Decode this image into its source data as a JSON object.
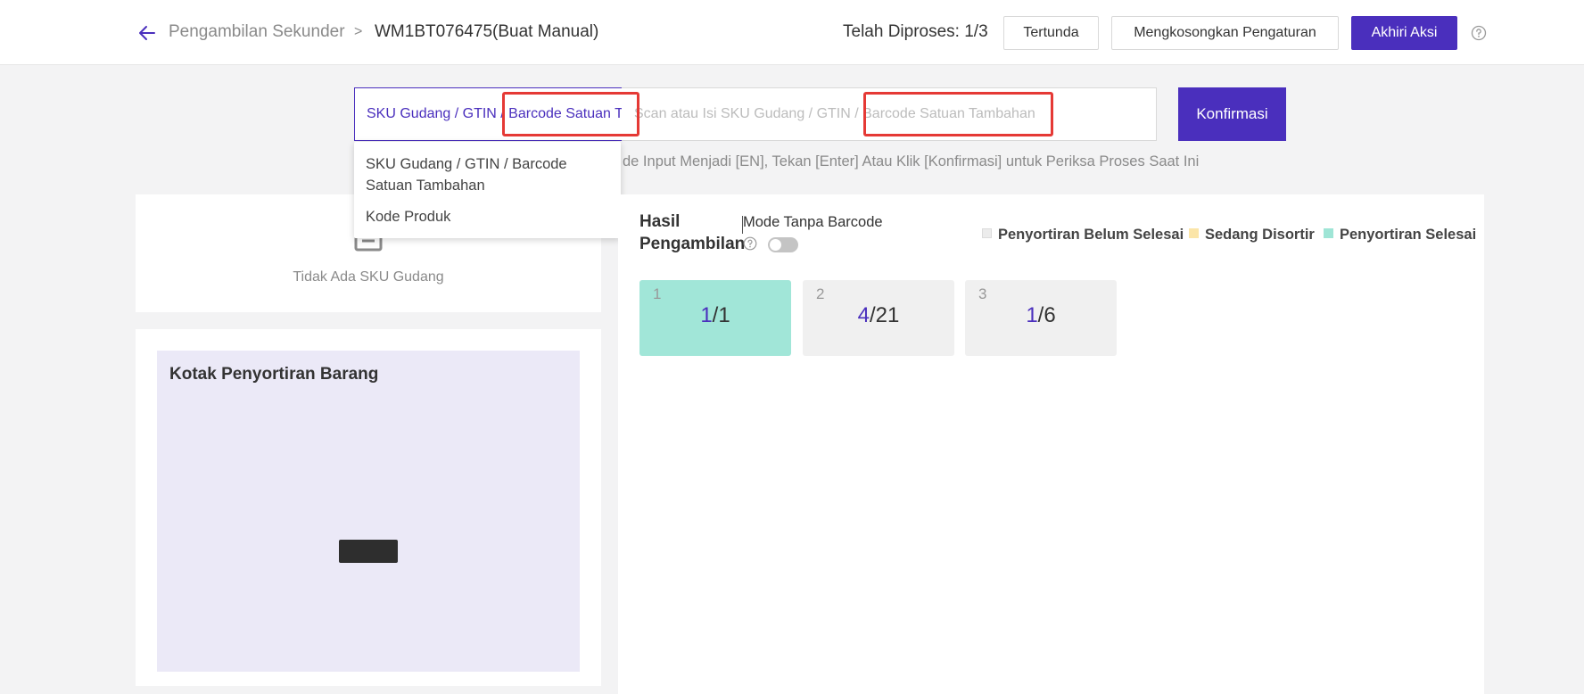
{
  "header": {
    "breadcrumb_parent": "Pengambilan Sekunder",
    "breadcrumb_separator": ">",
    "breadcrumb_current": "WM1BT076475(Buat Manual)",
    "progress": "Telah Diproses: 1/3",
    "pending_label": "Tertunda",
    "clear_settings_label": "Mengkosongkan Pengaturan",
    "end_action_label": "Akhiri Aksi",
    "help_icon": "question-circle-icon"
  },
  "scan": {
    "type_selected": "SKU Gudang / GTIN / Barcode Satuan Tambahan",
    "placeholder": "Scan atau Isi SKU Gudang / GTIN / Barcode Satuan Tambahan",
    "value": "",
    "confirm_label": "Konfirmasi",
    "hint": "de Input Menjadi [EN], Tekan [Enter] Atau Klik [Konfirmasi] untuk Periksa Proses Saat Ini",
    "dropdown_options": [
      "SKU Gudang / GTIN / Barcode Satuan Tambahan",
      "Kode Produk"
    ]
  },
  "sku_panel": {
    "empty_text": "Tidak Ada SKU Gudang"
  },
  "sorting_box": {
    "title": "Kotak Penyortiran Barang"
  },
  "result": {
    "title": "Hasil Pengambilan",
    "mode_label": "Mode Tanpa Barcode",
    "mode_enabled": false,
    "legend": [
      {
        "label": "Penyortiran Belum Selesai",
        "color": "#ececec"
      },
      {
        "label": "Sedang Disortir",
        "color": "#fbe5a8"
      },
      {
        "label": "Penyortiran Selesai",
        "color": "#9fe5d6"
      }
    ],
    "cards": [
      {
        "index": "1",
        "done": "1",
        "total": "/1",
        "status": "Penyortiran Selesai",
        "color": "#a1e6d8"
      },
      {
        "index": "2",
        "done": "4",
        "total": "/21",
        "status": "Penyortiran Belum Selesai",
        "color": "#f0f0f0"
      },
      {
        "index": "3",
        "done": "1",
        "total": "/6",
        "status": "Penyortiran Belum Selesai",
        "color": "#f0f0f0"
      }
    ]
  },
  "colors": {
    "primary": "#4a2fbd",
    "highlight": "#e53935"
  }
}
